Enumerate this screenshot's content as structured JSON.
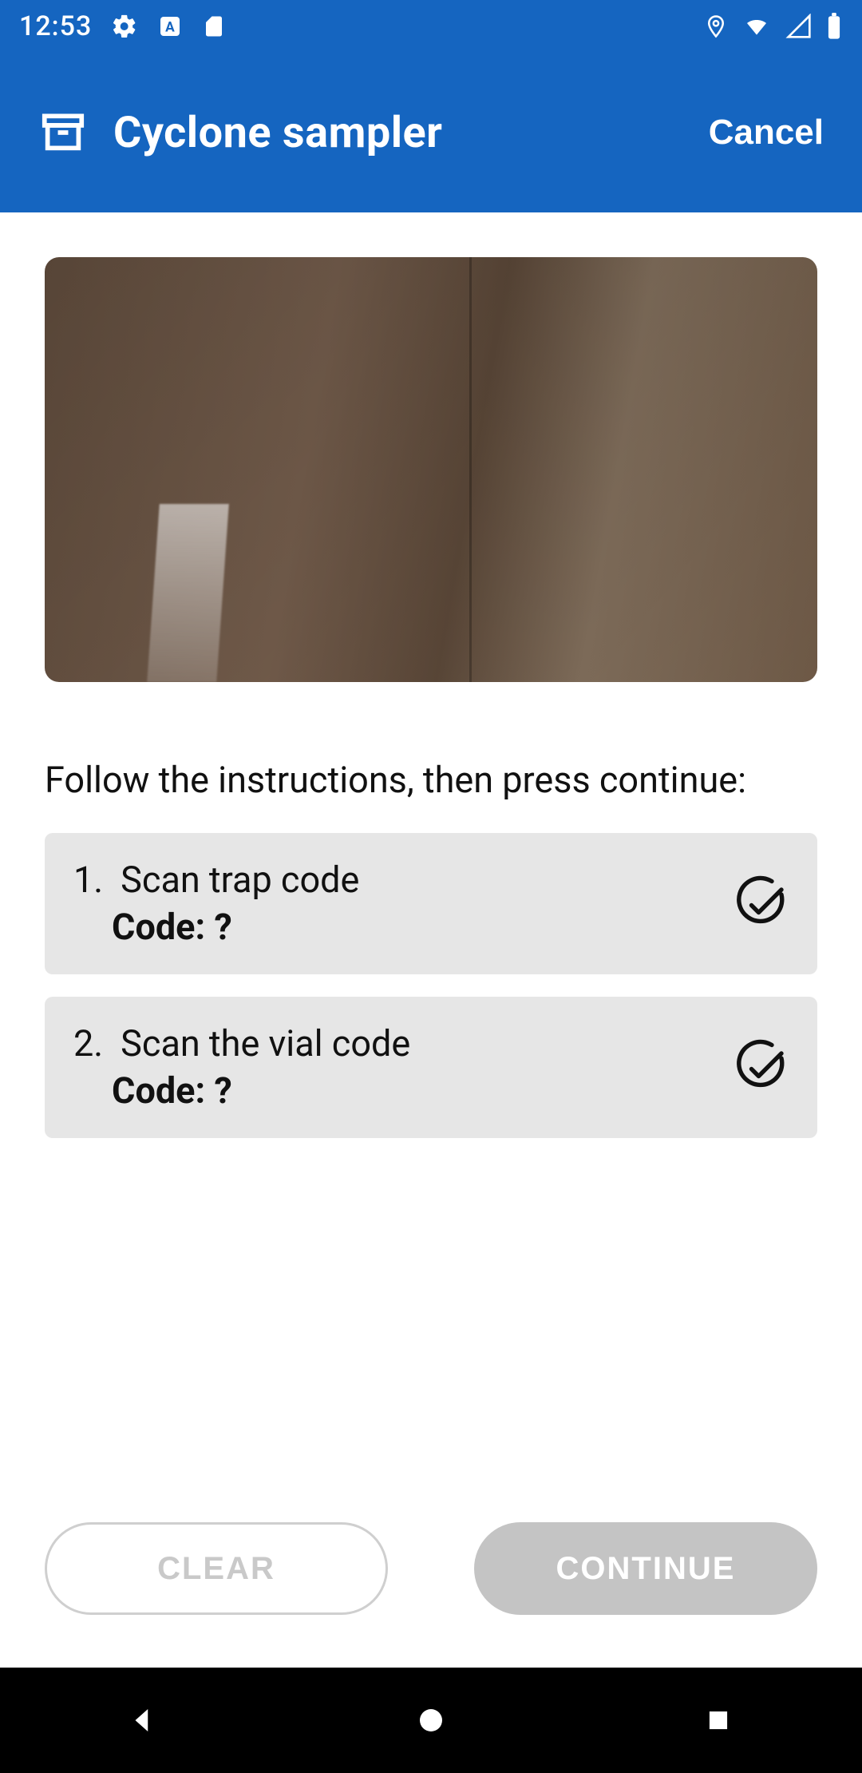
{
  "status": {
    "time": "12:53",
    "icons": [
      "gear",
      "language-a",
      "sd-card",
      "location-pin",
      "wifi",
      "cell-signal",
      "battery"
    ]
  },
  "appbar": {
    "title": "Cyclone sampler",
    "cancel_label": "Cancel"
  },
  "main": {
    "instructions": "Follow the instructions, then press continue:",
    "steps": [
      {
        "num": "1.",
        "title": "Scan trap code",
        "code_label": "Code: ?"
      },
      {
        "num": "2.",
        "title": "Scan the vial code",
        "code_label": "Code: ?"
      }
    ]
  },
  "buttons": {
    "clear": "CLEAR",
    "continue": "CONTINUE"
  }
}
